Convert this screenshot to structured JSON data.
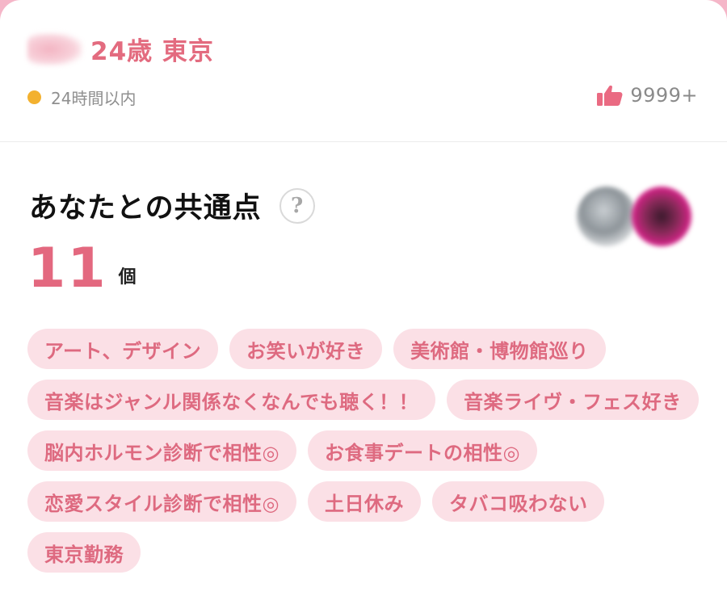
{
  "profile": {
    "age_location": "24歳 東京",
    "status_text": "24時間以内",
    "like_count": "9999+",
    "status_color": "#f3b12f",
    "accent_color": "#e36b7f"
  },
  "common": {
    "title": "あなたとの共通点",
    "help_label": "?",
    "count": "11",
    "count_unit": "個",
    "tags": [
      "アート、デザイン",
      "お笑いが好き",
      "美術館・博物館巡り",
      "音楽はジャンル関係なくなんでも聴く！！",
      "音楽ライヴ・フェス好き",
      "脳内ホルモン診断で相性◎",
      "お食事デートの相性◎",
      "恋愛スタイル診断で相性◎",
      "土日休み",
      "タバコ吸わない",
      "東京勤務"
    ]
  },
  "icons": {
    "like": "thumbs-up-icon",
    "help": "question-circle-icon",
    "status": "online-dot-icon"
  }
}
